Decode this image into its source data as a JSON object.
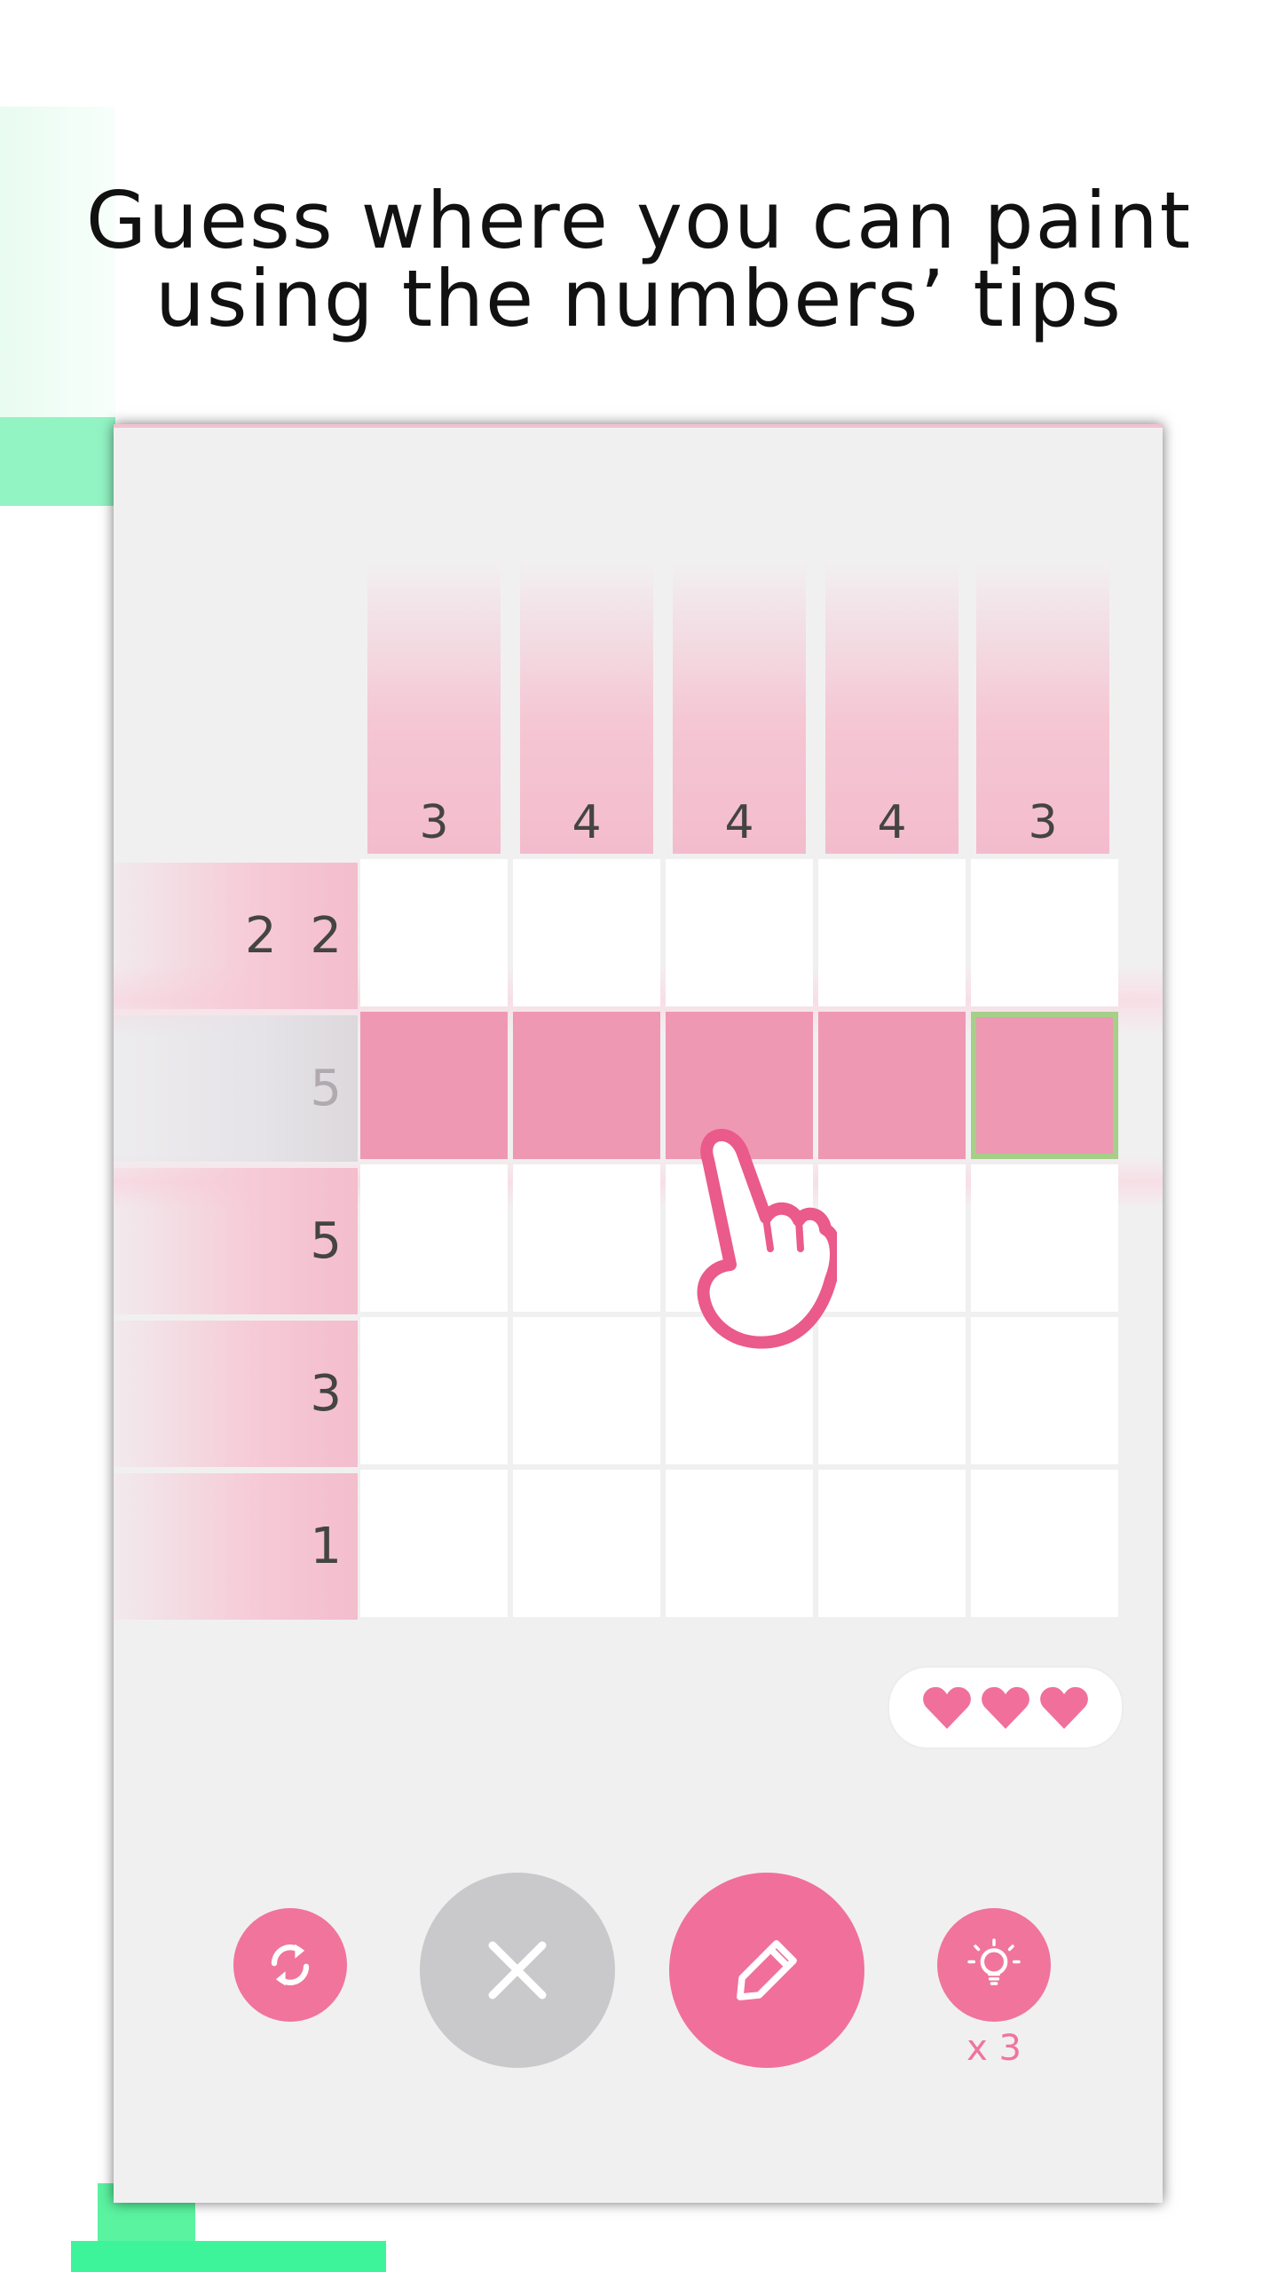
{
  "headline": {
    "line1": "Guess where you can paint",
    "line2": "using the numbers’ tips"
  },
  "puzzle": {
    "column_hints": [
      "3",
      "4",
      "4",
      "4",
      "3"
    ],
    "row_hints": [
      "2 2",
      "5",
      "5",
      "3",
      "1"
    ],
    "active_row": 1,
    "painted_cells": [
      [
        1,
        0
      ],
      [
        1,
        1
      ],
      [
        1,
        2
      ],
      [
        1,
        3
      ]
    ],
    "selected_cell": [
      1,
      4
    ]
  },
  "lives": {
    "count": 3,
    "icon": "heart-icon"
  },
  "controls": {
    "reset_icon": "refresh-icon",
    "cross_icon": "cross-icon",
    "paint_icon": "pencil-icon",
    "hint_icon": "lightbulb-icon",
    "hint_count": "x 3"
  },
  "colors": {
    "accent": "#f0709b",
    "painted": "#ee98b3",
    "selected_border": "#a6cf8a",
    "disabled_button": "#c9c8ca"
  }
}
